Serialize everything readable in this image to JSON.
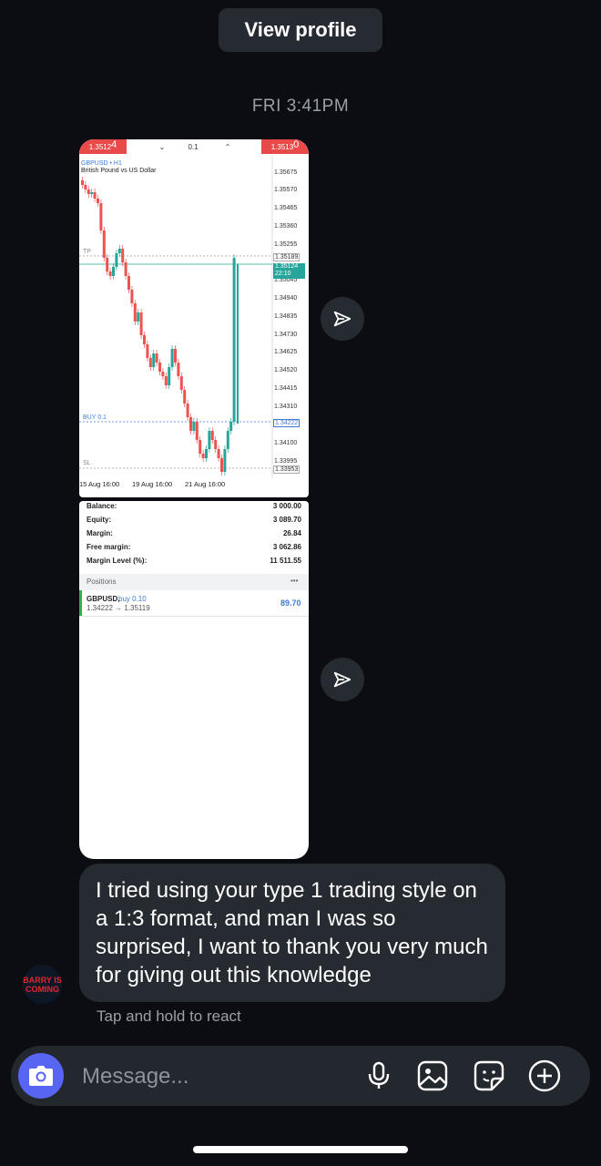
{
  "header": {
    "view_profile_label": "View profile"
  },
  "timestamp": "FRI 3:41PM",
  "screenshot1": {
    "bid": "1.3512",
    "bid_sup": "4",
    "lot": "0.1",
    "ask": "1.3513",
    "ask_sup": "0",
    "symbol": "GBPUSD • H1",
    "description": "British Pound vs US Dollar",
    "price_labels": [
      "1.35675",
      "1.35570",
      "1.35465",
      "1.35360",
      "1.35255",
      "1.35189",
      "1.35045",
      "1.34940",
      "1.34835",
      "1.34730",
      "1.34625",
      "1.34520",
      "1.34415",
      "1.34310",
      "1.34222",
      "1.34100",
      "1.33995",
      "1.33953"
    ],
    "current_price": "1.35124",
    "countdown": "22:10",
    "tp_label": "TP",
    "buy_label": "BUY 0.1",
    "sl_label": "SL",
    "x_labels": [
      "15 Aug 16:00",
      "19 Aug 16:00",
      "21 Aug 16:00"
    ],
    "colors": {
      "up": "#26a69a",
      "down": "#ef5350",
      "buy_line": "#3d7bd9"
    }
  },
  "screenshot2": {
    "account": [
      {
        "label": "Balance:",
        "value": "3 000.00"
      },
      {
        "label": "Equity:",
        "value": "3 089.70"
      },
      {
        "label": "Margin:",
        "value": "26.84"
      },
      {
        "label": "Free margin:",
        "value": "3 062.86"
      },
      {
        "label": "Margin Level (%):",
        "value": "11 511.55"
      }
    ],
    "positions_header": "Positions",
    "positions_menu": "•••",
    "position": {
      "symbol": "GBPUSD,",
      "side": "buy 0.10",
      "prices": "1.34222 → 1.35119",
      "profit": "89.70"
    }
  },
  "message": {
    "text": "I tried using your type 1 trading style on a 1:3 format, and man I was so surprised, I want to thank you very much for giving out this knowledge",
    "avatar_text": "BARRY IS COMING",
    "react_hint": "Tap and hold to react"
  },
  "composer": {
    "placeholder": "Message..."
  },
  "icons": {
    "share": "paper-plane-icon",
    "camera": "camera-icon",
    "mic": "microphone-icon",
    "gallery": "image-icon",
    "sticker": "sticker-icon",
    "add": "plus-circle-icon"
  },
  "colors": {
    "accent": "#5865f2",
    "bubble": "#262a31",
    "background": "#0b0d12"
  }
}
